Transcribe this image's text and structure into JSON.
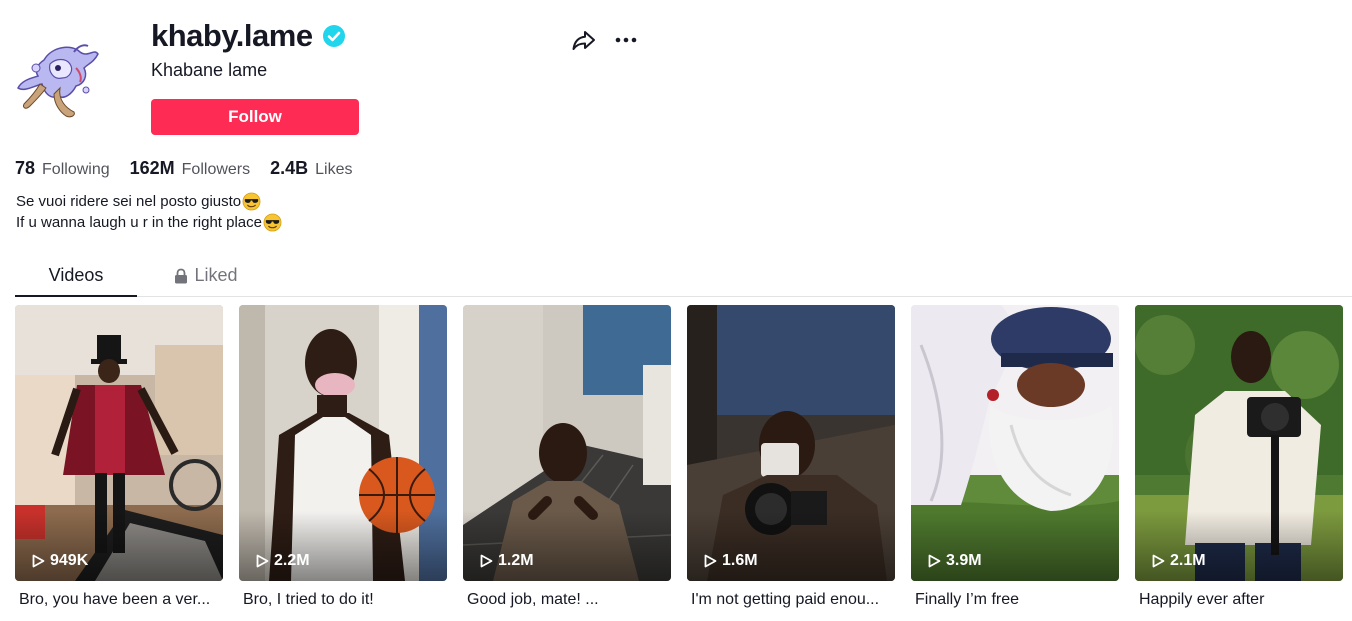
{
  "profile": {
    "username": "khaby.lame",
    "nickname": "Khabane lame",
    "follow_label": "Follow",
    "verified": true
  },
  "stats": [
    {
      "value": "78",
      "label": "Following"
    },
    {
      "value": "162M",
      "label": "Followers"
    },
    {
      "value": "2.4B",
      "label": "Likes"
    }
  ],
  "bio": {
    "line1": "Se vuoi ridere sei nel posto giusto",
    "line2": "If u wanna laugh u r in the right place",
    "emoji": "smiling-face-with-sunglasses-icon"
  },
  "tabs": {
    "videos": "Videos",
    "liked": "Liked"
  },
  "videos": [
    {
      "views": "949K",
      "caption": "Bro, you have been a ver..."
    },
    {
      "views": "2.2M",
      "caption": "Bro, I tried to do it!"
    },
    {
      "views": "1.2M",
      "caption": "Good job, mate! ..."
    },
    {
      "views": "1.6M",
      "caption": "I'm not getting paid enou..."
    },
    {
      "views": "3.9M",
      "caption": "Finally I’m free"
    },
    {
      "views": "2.1M",
      "caption": "Happily ever after"
    }
  ],
  "colors": {
    "follow": "#fe2c55",
    "verified": "#20d5ec",
    "text": "#161823"
  }
}
